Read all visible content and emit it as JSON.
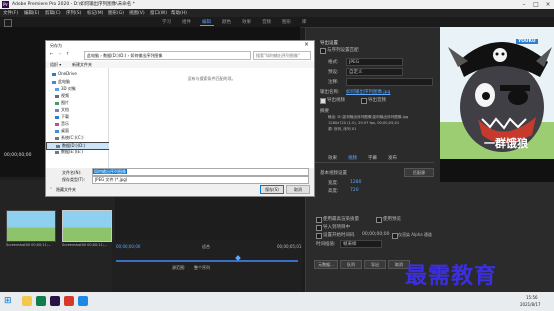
{
  "window": {
    "title": "Adobe Premiere Pro 2020 - D:\\如何输出序列图像\\未命名 *"
  },
  "menu": [
    "文件(F)",
    "编辑(E)",
    "剪辑(C)",
    "序列(S)",
    "标记(M)",
    "图形(G)",
    "视图(V)",
    "窗口(W)",
    "帮助(H)"
  ],
  "workspaces": [
    "学习",
    "组件",
    "编辑",
    "颜色",
    "效果",
    "音频",
    "图形",
    "库"
  ],
  "active_workspace_index": 2,
  "left_panel": {
    "timecode": "00;00;00;00",
    "timecode_right": "00;00;01;01"
  },
  "file_dialog": {
    "title": "另存为",
    "path": [
      "此电脑",
      "数据(D:)(D:)",
      "如何输出序列图像"
    ],
    "search_placeholder": "搜索\"如何输出序列图像\"",
    "organize": "组织 ▾",
    "new_folder": "新建文件夹",
    "empty_message": "没有与搜索条件匹配的项。",
    "sidebar": [
      {
        "label": "OneDrive",
        "color": "#2b7cd3"
      },
      {
        "label": "此电脑",
        "color": "#3b8ede"
      },
      {
        "label": "3D 对象",
        "color": "#5aa0e6"
      },
      {
        "label": "视频",
        "color": "#6b6b6b"
      },
      {
        "label": "图片",
        "color": "#4e9a6e"
      },
      {
        "label": "文档",
        "color": "#6e87b5"
      },
      {
        "label": "下载",
        "color": "#2e7ad1"
      },
      {
        "label": "音乐",
        "color": "#c44f8a"
      },
      {
        "label": "桌面",
        "color": "#3d8ee0"
      },
      {
        "label": "系统(C:)(C:)",
        "color": "#777777"
      },
      {
        "label": "数据(D:)(D:)",
        "color": "#777777"
      },
      {
        "label": "数据(E:)(E:)",
        "color": "#777777"
      }
    ],
    "selected_sidebar_index": 10,
    "filename_label": "文件名(N):",
    "filename_value": "如何输出序列图像",
    "filetype_label": "保存类型(T):",
    "filetype_value": "JPEG 文件 (*.jpg)",
    "hide_folders": "隐藏文件夹",
    "save_button": "保存(S)",
    "cancel_button": "取消"
  },
  "export": {
    "title": "导出设置",
    "match_seq": "与序列设置匹配",
    "format_label": "格式:",
    "format_value": "JPEG",
    "preset_label": "预设:",
    "preset_value": "自定义",
    "comment_label": "注释:",
    "output_label": "输出名称:",
    "output_value": "如何输出序列图像.jpg",
    "export_video": "导出视频",
    "export_audio": "导出音频",
    "summary_label": "摘要",
    "summary_output": "输出: D:\\如何输出序列图像\\如何输出序列图像.jpg",
    "summary_dims": "1280x720 (1.0), 29.97 fps, 00;00;05;01",
    "summary_source": "源: 序列, 序列 01",
    "tabs": [
      "效果",
      "视频",
      "字幕",
      "发布"
    ],
    "basic_video": "基本视频设置",
    "match_source": "匹配源",
    "width_label": "宽度:",
    "width_value": "1280",
    "height_label": "高度:",
    "height_value": "720",
    "max_render": "使用最高渲染质量",
    "use_previews": "使用预览",
    "import_project": "导入到项目中",
    "set_timecode": "设置开始时间码",
    "timecode_value": "00;00;00;00",
    "render_alpha": "仅渲染 Alpha 通道",
    "time_interp_label": "时间插值:",
    "time_interp_value": "帧采样",
    "meta_button": "元数据...",
    "queue_button": "队列",
    "export_button": "导出",
    "cancel_button": "取消",
    "source_range_label": "源范围:",
    "source_range_value": "整个序列",
    "fit_label": "适合",
    "tc_in": "00;00;00;00",
    "tc_out": "00;00;05;01"
  },
  "preview": {
    "logo": "YOUKU",
    "caption": "一群饿狼"
  },
  "project": {
    "clips": [
      {
        "name": "Screenshot00 00;00;11;..."
      },
      {
        "name": "Screenshot00 00;00;11;..."
      }
    ]
  },
  "taskbar": {
    "time": "15:56",
    "date": "2021/8/17"
  },
  "watermark": "最需教育"
}
